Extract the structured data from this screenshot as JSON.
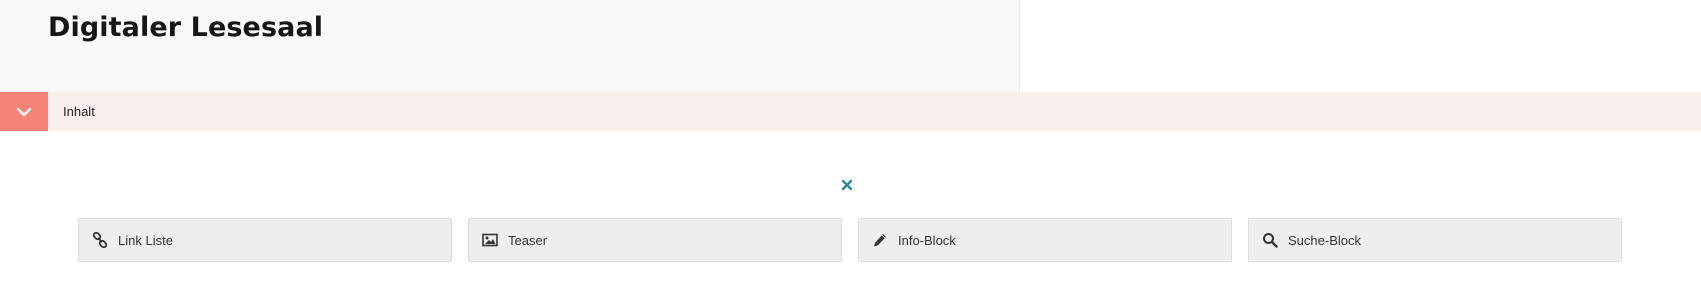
{
  "header": {
    "title": "Digitaler Lesesaal"
  },
  "section": {
    "label": "Inhalt",
    "toggle_icon": "chevron-down-icon",
    "accent_color": "#f58378",
    "bar_color": "#fbefee"
  },
  "close": {
    "icon": "close-icon",
    "color": "#2a8a8f"
  },
  "blocks": [
    {
      "label": "Link Liste",
      "icon": "link-icon"
    },
    {
      "label": "Teaser",
      "icon": "image-icon"
    },
    {
      "label": "Info-Block",
      "icon": "pencil-icon"
    },
    {
      "label": "Suche-Block",
      "icon": "search-icon"
    }
  ]
}
